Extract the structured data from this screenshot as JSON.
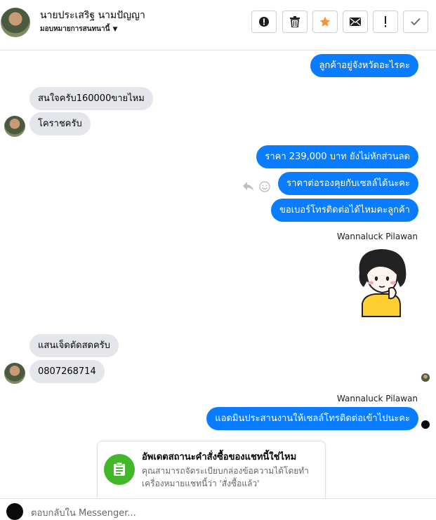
{
  "header": {
    "contact_name": "นายประเสริฐ นามปัญญา",
    "assign_label": "มอบหมายการสนทนานี้",
    "buttons": [
      {
        "name": "mark-spam",
        "icon": "alert-circle-icon"
      },
      {
        "name": "delete",
        "icon": "trash-icon"
      },
      {
        "name": "star",
        "icon": "star-icon",
        "color": "#f7923b"
      },
      {
        "name": "mark-unread",
        "icon": "envelope-icon"
      },
      {
        "name": "follow-up",
        "icon": "exclamation-icon"
      },
      {
        "name": "mark-done",
        "icon": "check-icon"
      }
    ]
  },
  "messages": {
    "m1": "ลูกค้าอยู่จังหวัดอะไรคะ",
    "m2": "สนใจครับ160000ขายไหม",
    "m3": "โคราชครับ",
    "m4": "ราคา 239,000 บาท  ยังไม่หักส่วนลด",
    "m5": "ราคาต่อรองคุยกับเซลล์ได้นะคะ",
    "m6": "ขอเบอร์โทรติดต่อได้ไหมคะลูกค้า",
    "sender1": "Wannaluck Pilawan",
    "m7": "แสนเจ็ดตัดสดครับ",
    "m8": "0807268714",
    "sender2": "Wannaluck Pilawan",
    "m9": "แอดมินประสานงานให้เซลล์โทรติดต่อเข้าไปนะคะ"
  },
  "card": {
    "title": "อัพเดตสถานะคำสั่งซื้อของแชทนี้ใช่ไหม",
    "body": "คุณสามารถจัดระเบียบกล่องข้อความได้โดยทำเครื่องหมายแชทนี้ว่า 'สั่งซื้อแล้ว'"
  },
  "composer": {
    "placeholder": "ตอบกลับใน Messenger..."
  },
  "colors": {
    "outgoing_bubble": "#0a7cff",
    "incoming_bubble": "#e4e6eb",
    "card_icon": "#42b72a"
  }
}
